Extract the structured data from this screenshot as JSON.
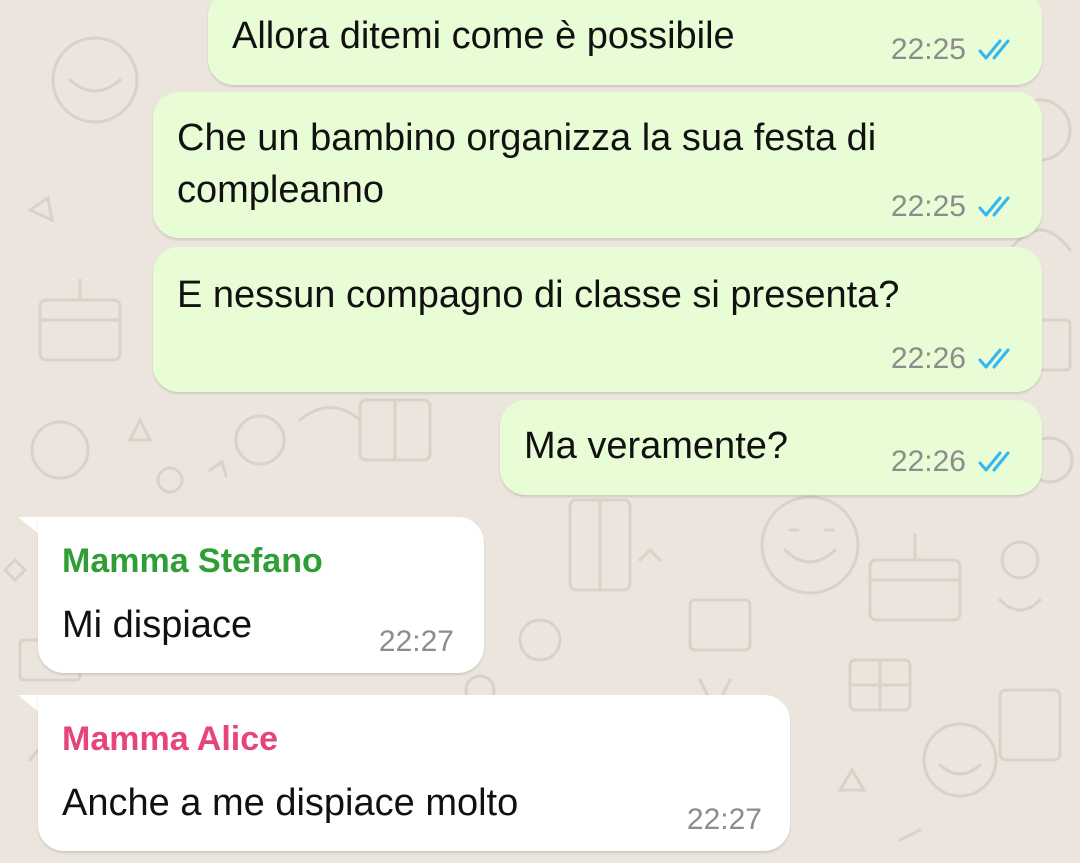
{
  "colors": {
    "outgoing_bubble": "#e8fdd6",
    "incoming_bubble": "#ffffff",
    "time": "#8c8c8c",
    "read_ticks": "#34b7f1",
    "sender_stefano": "#2e9e35",
    "sender_alice": "#e5457a",
    "wallpaper": "#ece5dd"
  },
  "messages": [
    {
      "direction": "outgoing",
      "text": "Allora ditemi come è possibile",
      "time": "22:25",
      "status": "read-double-check-icon"
    },
    {
      "direction": "outgoing",
      "text": "Che un bambino organizza la sua festa di compleanno",
      "time": "22:25",
      "status": "read-double-check-icon"
    },
    {
      "direction": "outgoing",
      "text": "E nessun compagno di classe si presenta?",
      "time": "22:26",
      "status": "read-double-check-icon"
    },
    {
      "direction": "outgoing",
      "text": "Ma veramente?",
      "time": "22:26",
      "status": "read-double-check-icon"
    },
    {
      "direction": "incoming",
      "sender": "Mamma Stefano",
      "text": "Mi dispiace",
      "time": "22:27"
    },
    {
      "direction": "incoming",
      "sender": "Mamma Alice",
      "text": "Anche a me dispiace molto",
      "time": "22:27"
    }
  ]
}
